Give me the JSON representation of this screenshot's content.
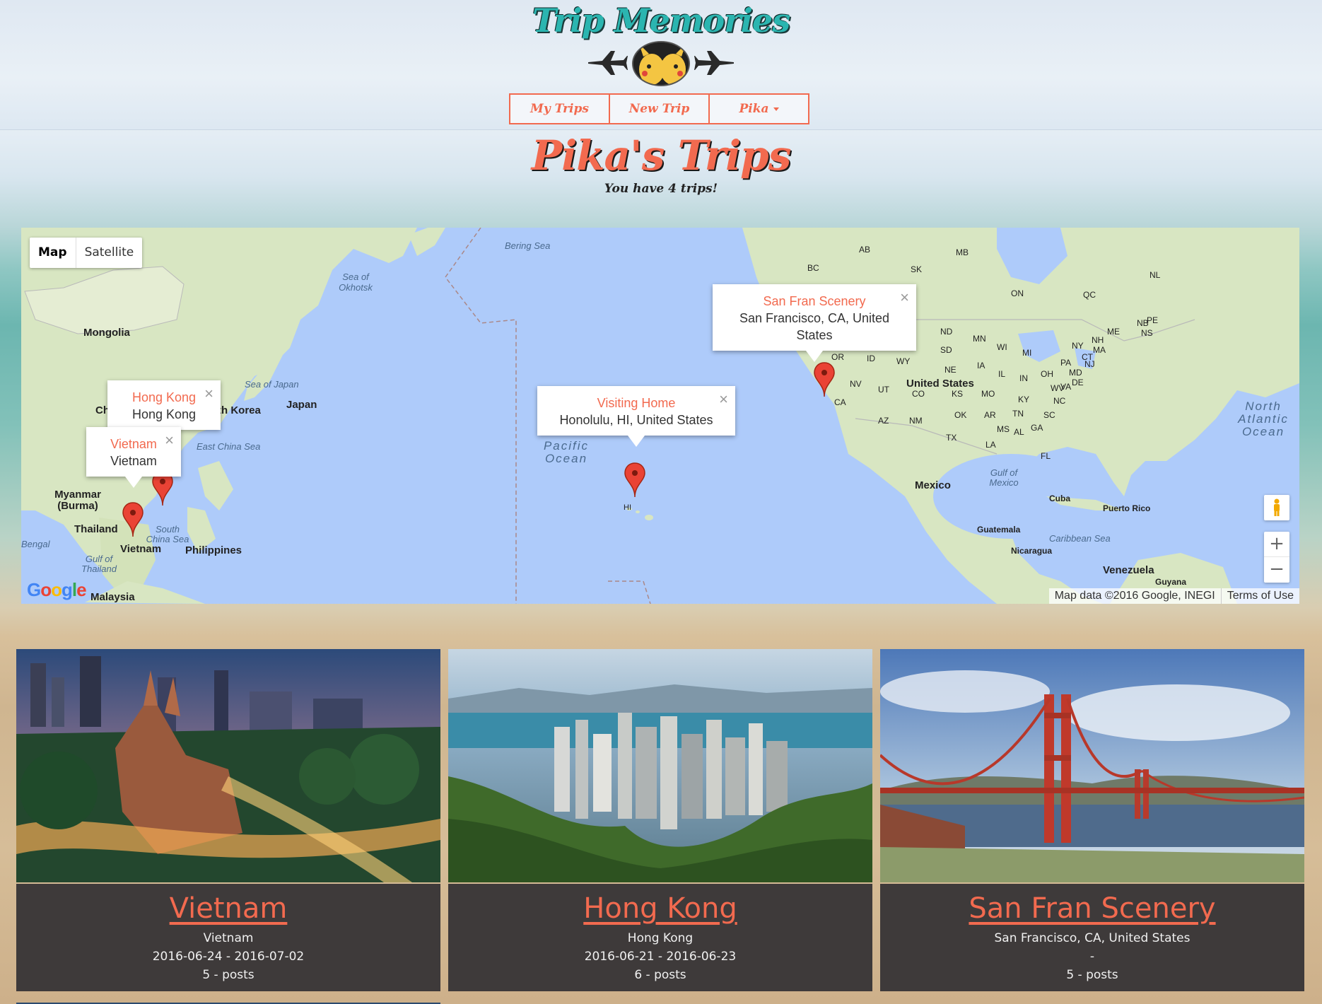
{
  "brand": {
    "title": "Trip Memories"
  },
  "nav": {
    "my_trips": "My Trips",
    "new_trip": "New Trip",
    "user": "Pika"
  },
  "page": {
    "title": "Pika's Trips",
    "subtitle": "You have 4 trips!"
  },
  "map": {
    "type_controls": {
      "map": "Map",
      "satellite": "Satellite",
      "active": "Map"
    },
    "labels": {
      "bering_sea": "Bering Sea",
      "sea_of_okhotsk": "Sea of Okhotsk",
      "mongolia": "Mongolia",
      "sea_of_japan": "Sea of Japan",
      "japan": "Japan",
      "south_korea": "th Korea",
      "china": "Ch",
      "east_china_sea": "East China Sea",
      "myanmar": "Myanmar (Burma)",
      "thailand": "Thailand",
      "bengal": "Bengal",
      "gulf_of_thailand": "Gulf of Thailand",
      "vietnam": "Vietnam",
      "south_china_sea": "South China Sea",
      "philippines": "Philippines",
      "malaysia": "Malaysia",
      "pacific_ocean": "Pacific Ocean",
      "hi": "HI",
      "ab": "AB",
      "bc": "BC",
      "sk": "SK",
      "mb": "MB",
      "on": "ON",
      "qc": "QC",
      "nl": "NL",
      "nb": "NB",
      "pe": "PE",
      "ns": "NS",
      "me": "ME",
      "nh": "NH",
      "ma": "MA",
      "ny": "NY",
      "pa": "PA",
      "md": "MD",
      "de": "DE",
      "nj": "NJ",
      "ct": "CT",
      "or": "OR",
      "id": "ID",
      "wy": "WY",
      "nd": "ND",
      "sd": "SD",
      "mn": "MN",
      "wi": "WI",
      "mi": "MI",
      "ne": "NE",
      "ia": "IA",
      "il": "IL",
      "in": "IN",
      "oh": "OH",
      "wv": "WV",
      "va": "VA",
      "nv": "NV",
      "ut": "UT",
      "co": "CO",
      "ks": "KS",
      "mo": "MO",
      "ky": "KY",
      "nc": "NC",
      "ca": "CA",
      "az": "AZ",
      "nm": "NM",
      "ok": "OK",
      "ar": "AR",
      "tn": "TN",
      "sc": "SC",
      "tx": "TX",
      "la": "LA",
      "ms": "MS",
      "al": "AL",
      "ga": "GA",
      "fl": "FL",
      "united_states": "United States",
      "north_atlantic_ocean": "North Atlantic Ocean",
      "gulf_of_mexico": "Gulf of Mexico",
      "mexico": "Mexico",
      "cuba": "Cuba",
      "puerto_rico": "Puerto Rico",
      "guatemala": "Guatemala",
      "caribbean_sea": "Caribbean Sea",
      "nicaragua": "Nicaragua",
      "venezuela": "Venezuela",
      "guyana": "Guyana"
    },
    "infowindows": [
      {
        "title": "Hong Kong",
        "address": "Hong Kong"
      },
      {
        "title": "Vietnam",
        "address": "Vietnam"
      },
      {
        "title": "Visiting Home",
        "address": "Honolulu, HI, United States"
      },
      {
        "title": "San Fran Scenery",
        "address": "San Francisco, CA, United States"
      }
    ],
    "zoom": {
      "in": "+",
      "out": "−"
    },
    "attribution": {
      "data": "Map data ©2016 Google, INEGI",
      "terms": "Terms of Use"
    },
    "google_logo": "Google"
  },
  "trips": [
    {
      "title": "Vietnam",
      "location": "Vietnam",
      "dates": "2016-06-24 - 2016-07-02",
      "posts": "5 - posts"
    },
    {
      "title": "Hong Kong",
      "location": "Hong Kong",
      "dates": "2016-06-21 - 2016-06-23",
      "posts": "6 - posts"
    },
    {
      "title": "San Fran Scenery",
      "location": "San Francisco, CA, United States",
      "dates": "-",
      "posts": "5 - posts"
    }
  ],
  "colors": {
    "accent": "#f26a4f",
    "brand_teal": "#2bb5b0",
    "card_body": "#3e3a3a",
    "map_water": "#aecbfa",
    "map_land": "#d8e6c2"
  }
}
